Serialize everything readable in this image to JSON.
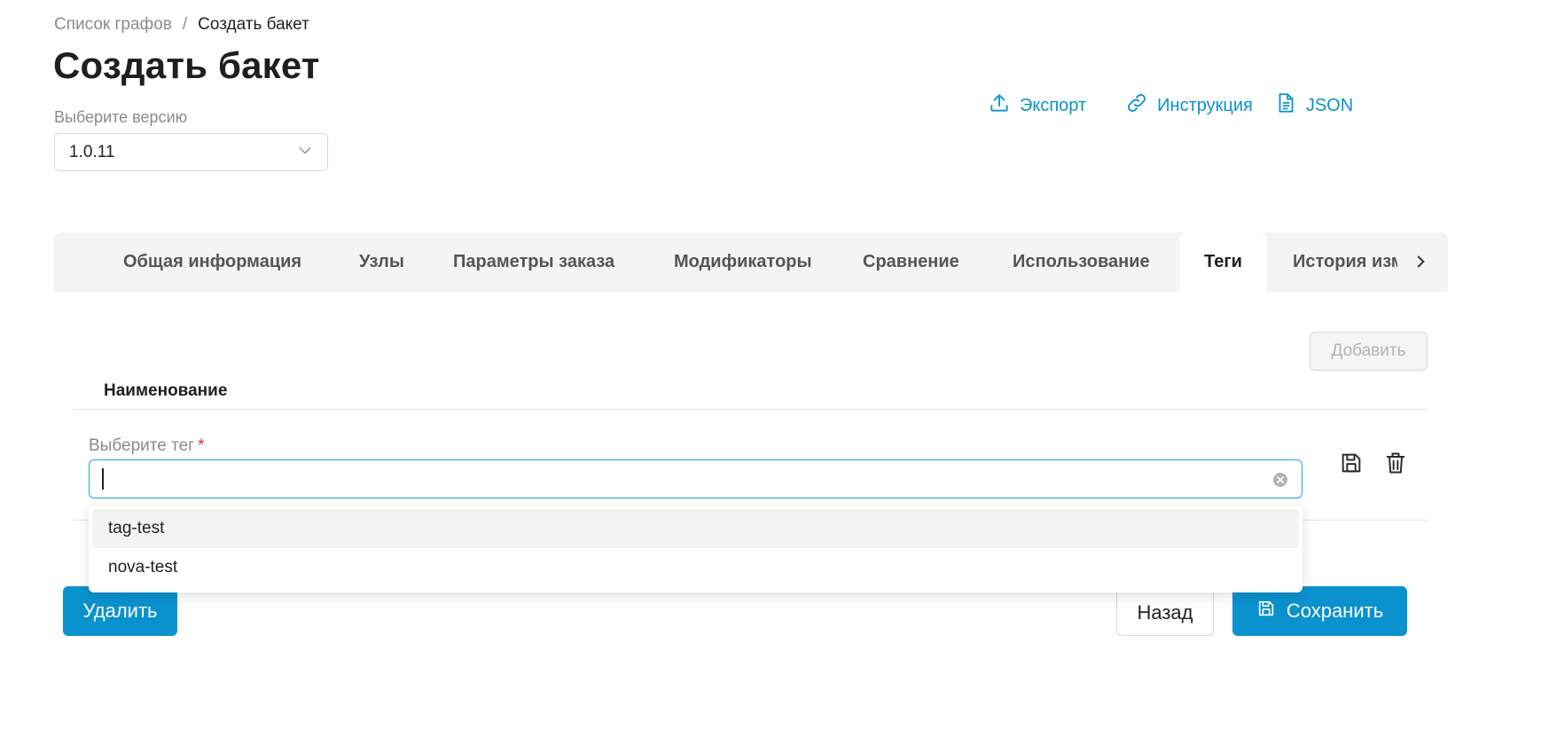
{
  "breadcrumb": {
    "parent": "Список графов",
    "separator": "/",
    "current": "Создать бакет"
  },
  "page_title": "Создать бакет",
  "version": {
    "label": "Выберите версию",
    "selected": "1.0.11"
  },
  "toolbar": {
    "export": "Экспорт",
    "instruction": "Инструкция",
    "json": "JSON"
  },
  "tabs": [
    {
      "label": "Общая информация"
    },
    {
      "label": "Узлы"
    },
    {
      "label": "Параметры заказа"
    },
    {
      "label": "Модификаторы"
    },
    {
      "label": "Сравнение"
    },
    {
      "label": "Использование"
    },
    {
      "label": "Теги",
      "active": true
    },
    {
      "label": "История изменений"
    }
  ],
  "add_button": "Добавить",
  "table": {
    "column_header": "Наименование"
  },
  "tag_field": {
    "label": "Выберите тег",
    "required_mark": "*",
    "value": ""
  },
  "dropdown_options": [
    "tag-test",
    "nova-test"
  ],
  "footer": {
    "delete": "Удалить",
    "back": "Назад",
    "save": "Сохранить"
  },
  "colors": {
    "accent": "#0a92cf",
    "focus_border": "#1fa3dc",
    "required": "#e03131",
    "tabs_bg": "#f4f4f4"
  },
  "icons": [
    "upload-icon",
    "link-icon",
    "document-icon",
    "chevron-down-icon",
    "chevron-right-icon",
    "clear-icon",
    "save-icon",
    "trash-icon"
  ]
}
